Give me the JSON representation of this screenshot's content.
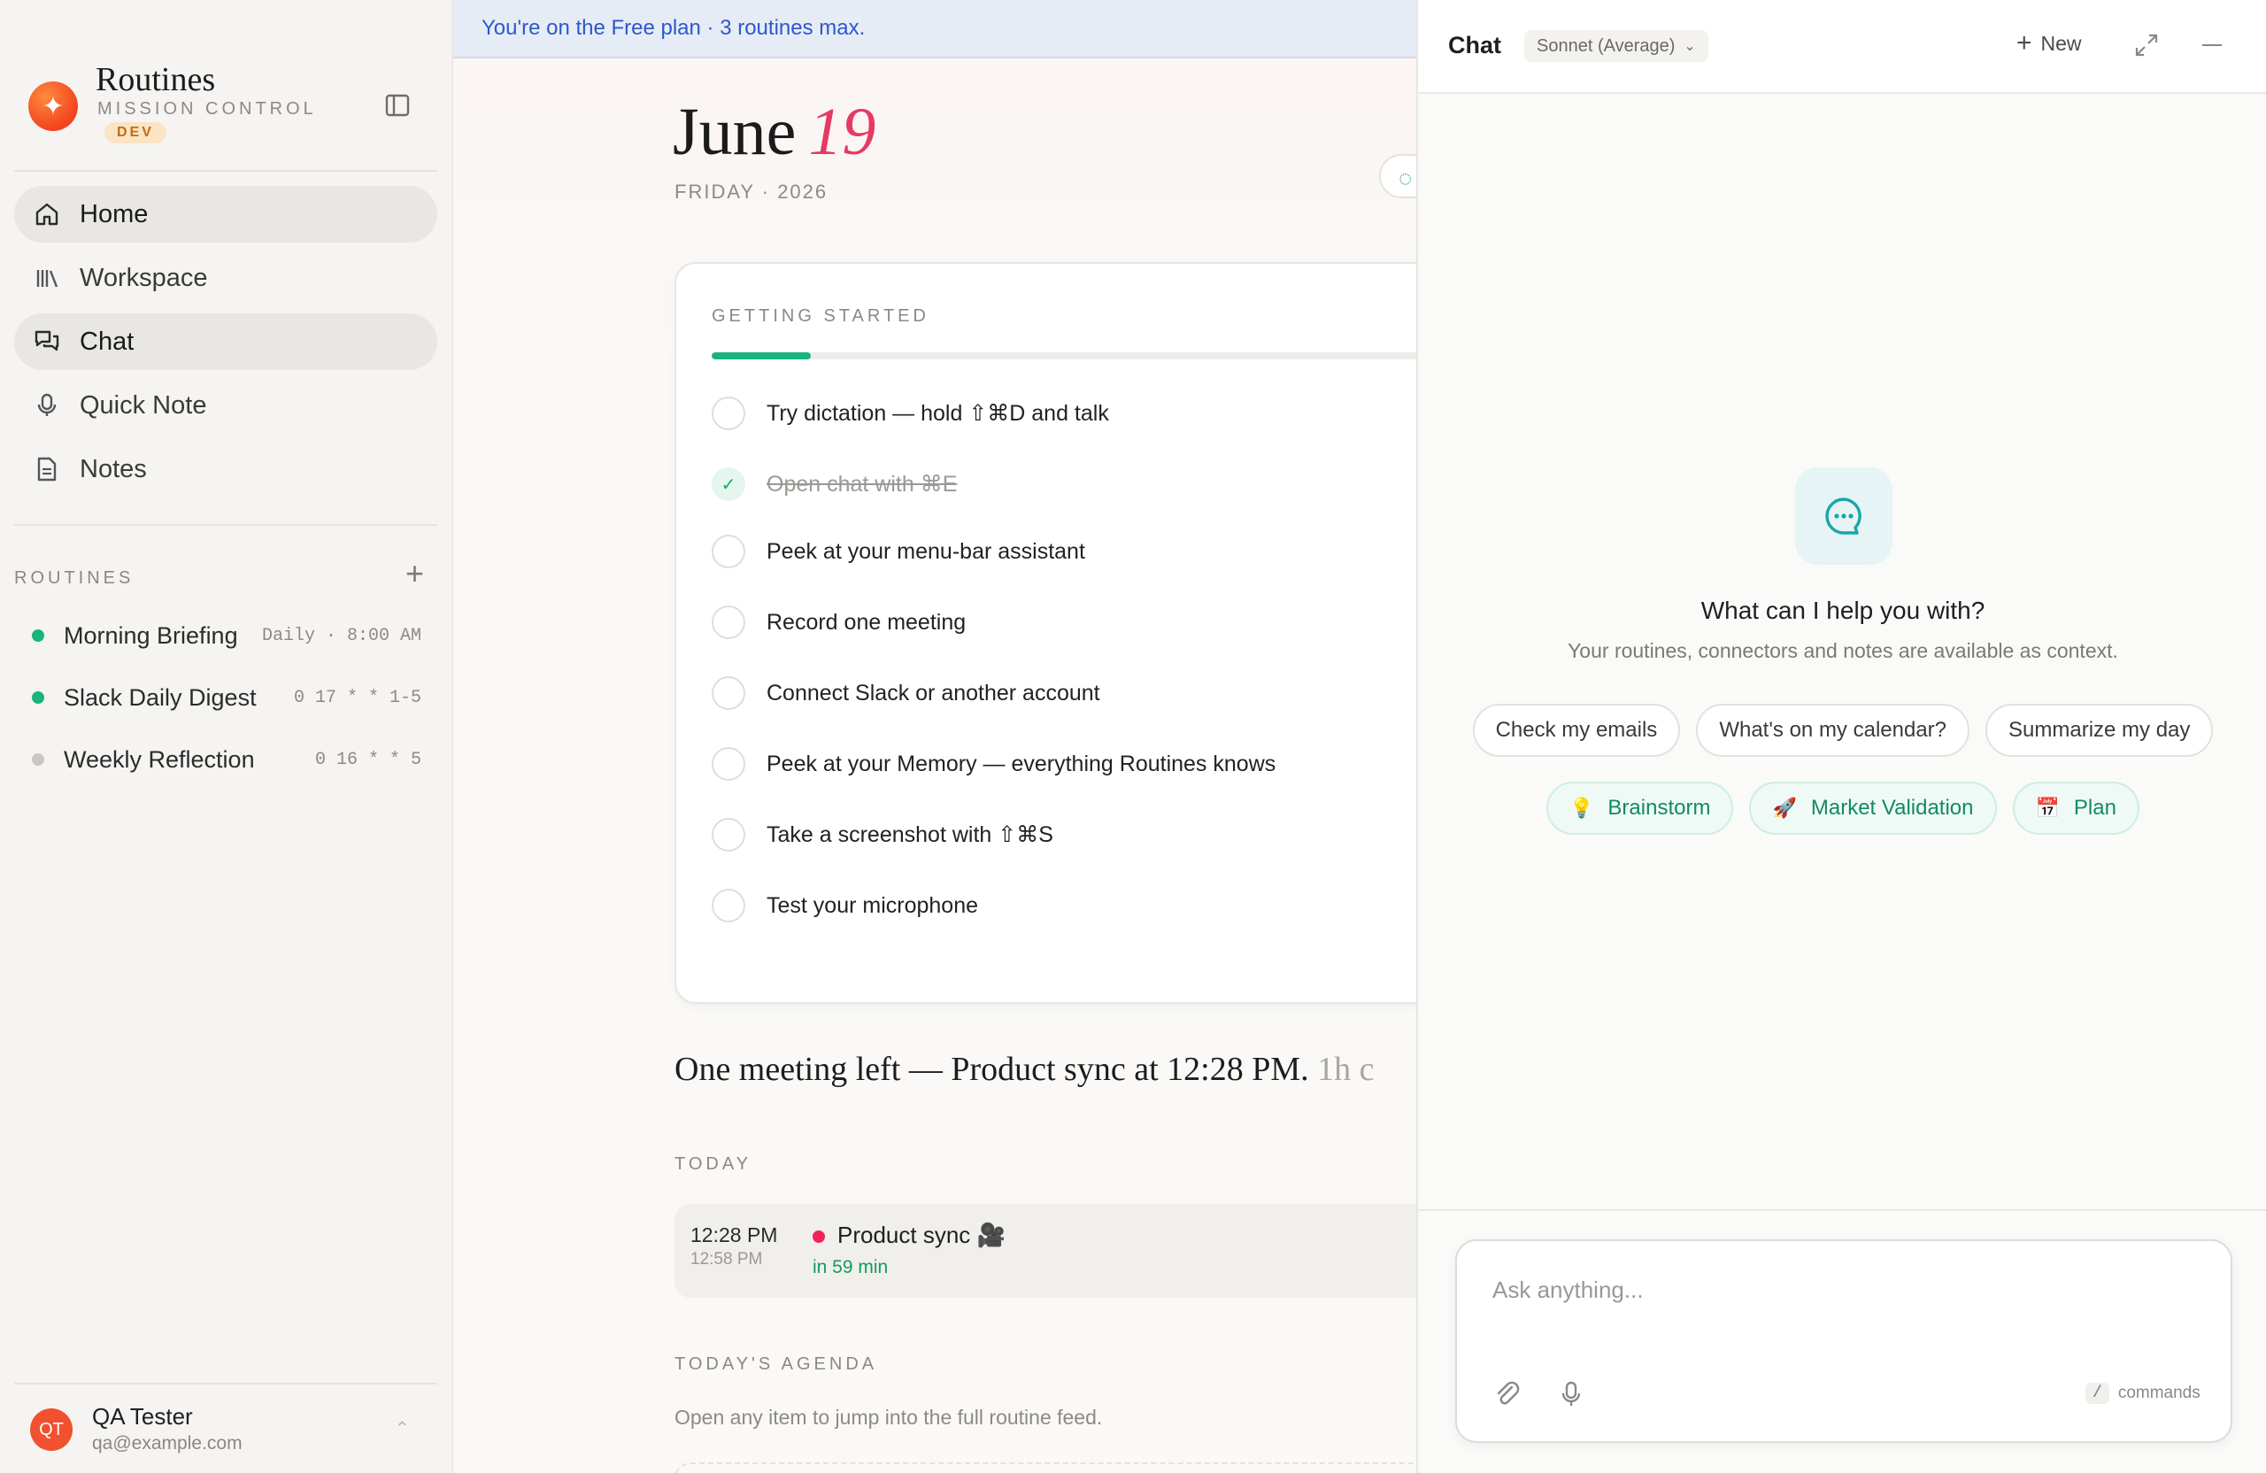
{
  "banner": {
    "text": "You're on the Free plan · 3 routines max."
  },
  "brand": {
    "title": "Routines",
    "subtitle": "MISSION CONTROL",
    "badge": "DEV"
  },
  "nav": {
    "home": "Home",
    "workspace": "Workspace",
    "chat": "Chat",
    "quick_note": "Quick Note",
    "notes": "Notes"
  },
  "routines": {
    "label": "ROUTINES",
    "items": [
      {
        "name": "Morning Briefing",
        "schedule": "Daily · 8:00 AM",
        "status_color": "#18b47c"
      },
      {
        "name": "Slack Daily Digest",
        "schedule": "0 17 * * 1-5",
        "status_color": "#18b47c"
      },
      {
        "name": "Weekly Reflection",
        "schedule": "0 16 * * 5",
        "status_color": "#c9c7c3"
      }
    ]
  },
  "user": {
    "initials": "QT",
    "name": "QA Tester",
    "email": "qa@example.com"
  },
  "home": {
    "month": "June",
    "day": "19",
    "weekday_year": "FRIDAY · 2026",
    "getting_started": {
      "label": "GETTING STARTED",
      "progress_fraction": 0.13,
      "tasks": [
        {
          "label": "Try dictation — hold ⇧⌘D and talk",
          "done": false
        },
        {
          "label": "Open chat with ⌘E",
          "done": true
        },
        {
          "label": "Peek at your menu-bar assistant",
          "done": false
        },
        {
          "label": "Record one meeting",
          "done": false
        },
        {
          "label": "Connect Slack or another account",
          "done": false
        },
        {
          "label": "Peek at your Memory — everything Routines knows",
          "done": false
        },
        {
          "label": "Take a screenshot with ⇧⌘S",
          "done": false
        },
        {
          "label": "Test your microphone",
          "done": false
        }
      ]
    },
    "meeting_summary": "One meeting left — Product sync at 12:28 PM.",
    "meeting_summary_muted": "1h c",
    "today_label": "TODAY",
    "event": {
      "start": "12:28 PM",
      "end": "12:58 PM",
      "title": "Product sync 🎥",
      "relative": "in 59 min"
    },
    "agenda_label": "TODAY'S AGENDA",
    "agenda_sub": "Open any item to jump into the full routine feed."
  },
  "chat": {
    "title": "Chat",
    "model": "Sonnet (Average)",
    "new_label": "New",
    "empty_title": "What can I help you with?",
    "empty_sub": "Your routines, connectors and notes are available as context.",
    "suggestions": [
      "Check my emails",
      "What's on my calendar?",
      "Summarize my day"
    ],
    "modes": [
      {
        "emoji": "💡",
        "label": "Brainstorm"
      },
      {
        "emoji": "🚀",
        "label": "Market Validation"
      },
      {
        "emoji": "📅",
        "label": "Plan"
      }
    ],
    "composer_placeholder": "Ask anything...",
    "commands_key": "/",
    "commands_label": "commands"
  },
  "icons": {
    "home": "home-icon",
    "workspace": "library-icon",
    "chat": "chat-bubbles-icon",
    "quick_note": "microphone-icon",
    "notes": "document-icon",
    "logo": "sparkle-icon"
  }
}
